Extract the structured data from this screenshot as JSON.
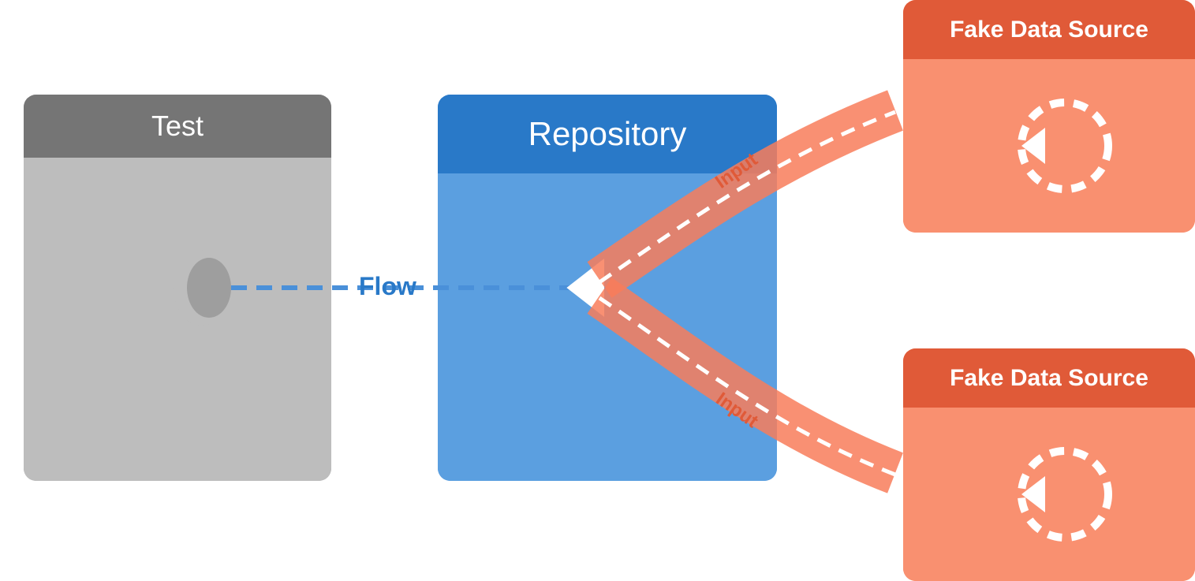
{
  "test_block": {
    "header": "Test"
  },
  "repo_block": {
    "header": "Repository"
  },
  "fds_top": {
    "header": "Fake Data Source",
    "input_label": "Input"
  },
  "fds_bottom": {
    "header": "Fake Data Source",
    "input_label": "Input"
  },
  "flow_label": "Flow",
  "colors": {
    "blue_dark": "#2979c8",
    "blue_mid": "#4a90d9",
    "blue_light": "#5b9fe0",
    "gray_dark": "#757575",
    "gray_mid": "#9e9e9e",
    "gray_light": "#bdbdbd",
    "orange_dark": "#e05a38",
    "orange_mid": "#f87c5a",
    "orange_light": "#f99070",
    "white": "#ffffff"
  }
}
